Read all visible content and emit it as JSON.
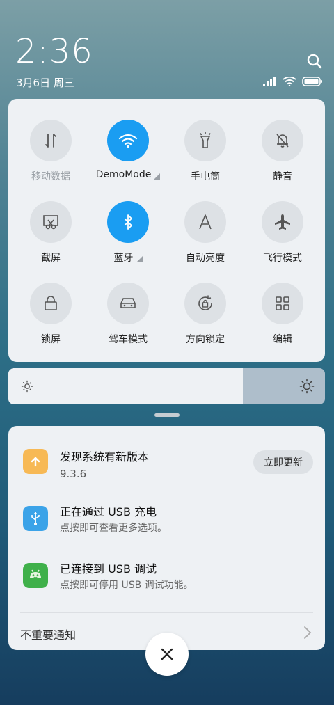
{
  "status": {
    "time": "2:36",
    "date": "3月6日 周三"
  },
  "quick_settings": {
    "tiles": [
      {
        "label": "移动数据",
        "icon": "mobile-data-icon",
        "active": false
      },
      {
        "label": "DemoMode",
        "icon": "wifi-icon",
        "active": true
      },
      {
        "label": "手电筒",
        "icon": "flashlight-icon",
        "active": false
      },
      {
        "label": "静音",
        "icon": "bell-off-icon",
        "active": false
      },
      {
        "label": "截屏",
        "icon": "screenshot-icon",
        "active": false
      },
      {
        "label": "蓝牙",
        "icon": "bluetooth-icon",
        "active": true
      },
      {
        "label": "自动亮度",
        "icon": "auto-brightness-icon",
        "active": false
      },
      {
        "label": "飞行模式",
        "icon": "airplane-icon",
        "active": false
      },
      {
        "label": "锁屏",
        "icon": "lock-icon",
        "active": false
      },
      {
        "label": "驾车模式",
        "icon": "car-icon",
        "active": false
      },
      {
        "label": "方向锁定",
        "icon": "rotation-lock-icon",
        "active": false
      },
      {
        "label": "编辑",
        "icon": "grid-icon",
        "active": false
      }
    ]
  },
  "brightness": {
    "level": 0.74
  },
  "notifications": {
    "items": [
      {
        "title": "发现系统有新版本",
        "subtitle": "9.3.6",
        "icon": "update-arrow-icon",
        "color": "#f7b955",
        "action": "立即更新"
      },
      {
        "title": "正在通过 USB 充电",
        "subtitle": "点按即可查看更多选项。",
        "icon": "usb-icon",
        "color": "#3ba3e8"
      },
      {
        "title": "已连接到 USB 调试",
        "subtitle": "点按即可停用 USB 调试功能。",
        "icon": "android-icon",
        "color": "#3fb04a"
      }
    ],
    "unimportant_label": "不重要通知"
  },
  "colors": {
    "accent": "#1a9df2",
    "panel": "#eef1f4",
    "tile_off": "#dde1e5"
  }
}
